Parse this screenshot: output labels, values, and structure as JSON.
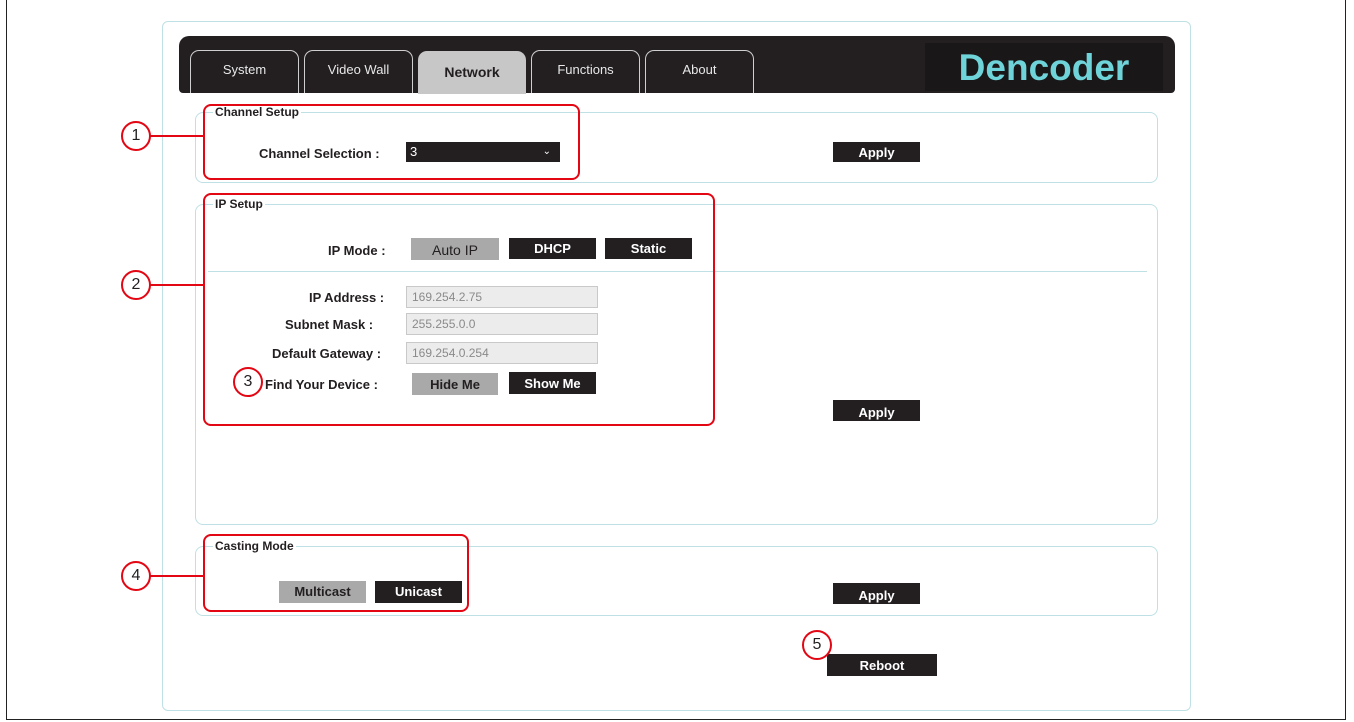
{
  "tabs": [
    {
      "label": "System",
      "active": false
    },
    {
      "label": "Video Wall",
      "active": false
    },
    {
      "label": "Network",
      "active": true
    },
    {
      "label": "Functions",
      "active": false
    },
    {
      "label": "About",
      "active": false
    }
  ],
  "brand": "Dencoder",
  "channel_setup": {
    "legend": "Channel Setup",
    "selection_label": "Channel Selection :",
    "selection_value": "3",
    "apply_label": "Apply"
  },
  "ip_setup": {
    "legend": "IP Setup",
    "mode_label": "IP Mode :",
    "modes": [
      {
        "label": "Auto IP",
        "selected": true
      },
      {
        "label": "DHCP",
        "selected": false
      },
      {
        "label": "Static",
        "selected": false
      }
    ],
    "ip_address_label": "IP Address :",
    "ip_address_value": "169.254.2.75",
    "subnet_mask_label": "Subnet Mask :",
    "subnet_mask_value": "255.255.0.0",
    "gateway_label": "Default Gateway :",
    "gateway_value": "169.254.0.254",
    "find_label": "Find Your Device :",
    "hide_me_label": "Hide Me",
    "show_me_label": "Show Me",
    "apply_label": "Apply"
  },
  "casting_mode": {
    "legend": "Casting Mode",
    "multicast_label": "Multicast",
    "unicast_label": "Unicast",
    "selected": "Multicast",
    "apply_label": "Apply"
  },
  "reboot_label": "Reboot",
  "callouts": [
    "1",
    "2",
    "3",
    "4",
    "5"
  ],
  "colors": {
    "bar": "#231f20",
    "brand_text": "#6fd4d9",
    "selected_button": "#a9a9a9",
    "fieldset_border": "#bfe0e4",
    "callout_red": "#e30613"
  }
}
